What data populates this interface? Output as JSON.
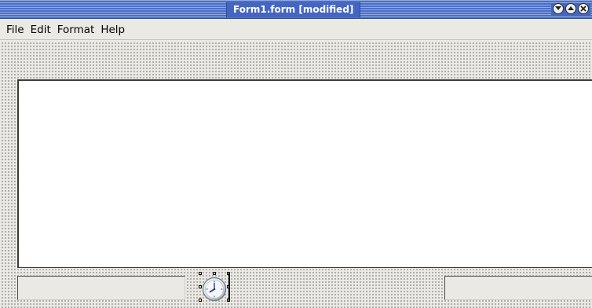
{
  "window": {
    "title": "Form1.form [modified]",
    "buttons": [
      "minimize-icon",
      "maximize-icon",
      "close-icon"
    ]
  },
  "menu": {
    "items": [
      "File",
      "Edit",
      "Format",
      "Help"
    ]
  },
  "colors": {
    "titlebar": "#4d6fc6",
    "surface": "#ebe9e3",
    "textarea": "#ffffff"
  },
  "widgets": {
    "timer": {
      "icon": "clock-icon",
      "selected": true
    }
  }
}
